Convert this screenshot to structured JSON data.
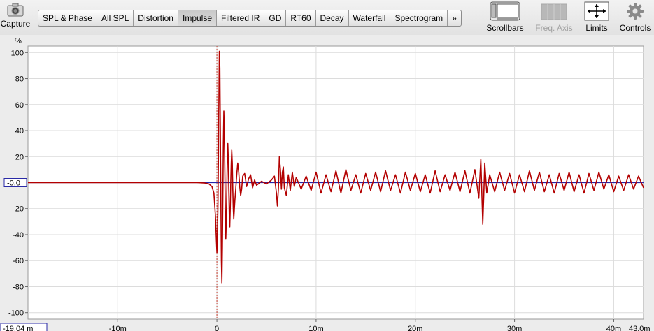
{
  "toolbar": {
    "capture_label": "Capture",
    "scrollbars_label": "Scrollbars",
    "freq_axis_label": "Freq. Axis",
    "limits_label": "Limits",
    "controls_label": "Controls",
    "tabs": [
      {
        "label": "SPL & Phase",
        "active": false
      },
      {
        "label": "All SPL",
        "active": false
      },
      {
        "label": "Distortion",
        "active": false
      },
      {
        "label": "Impulse",
        "active": true
      },
      {
        "label": "Filtered IR",
        "active": false
      },
      {
        "label": "GD",
        "active": false
      },
      {
        "label": "RT60",
        "active": false
      },
      {
        "label": "Decay",
        "active": false
      },
      {
        "label": "Waterfall",
        "active": false
      },
      {
        "label": "Spectrogram",
        "active": false
      },
      {
        "label": "»",
        "active": false
      }
    ]
  },
  "chart_data": {
    "type": "line",
    "ylabel": "%",
    "xlim": [
      -19.04,
      43.0
    ],
    "ylim": [
      -105,
      105
    ],
    "xunit": "m",
    "yticks": [
      100,
      80,
      60,
      40,
      20,
      -20,
      -40,
      -60,
      -80,
      -100
    ],
    "xticks": [
      {
        "value": -10,
        "label": "-10m"
      },
      {
        "value": 0,
        "label": "0"
      },
      {
        "value": 10,
        "label": "10m"
      },
      {
        "value": 20,
        "label": "20m"
      },
      {
        "value": 30,
        "label": "30m"
      },
      {
        "value": 40,
        "label": "40m"
      }
    ],
    "x_start_label": "-19.04 m",
    "x_end_label": "43.0m",
    "y_cursor_label": "-0.0",
    "grid": true,
    "cursor_x": 0,
    "colors": {
      "impulse": "#b30000",
      "envelope": "#2424a8",
      "cursor": "#c0392b",
      "axis_box": "#2a2aa6"
    },
    "series": [
      {
        "points": [
          [
            -19.04,
            0
          ],
          [
            -2,
            0
          ],
          [
            -1.2,
            -0.3
          ],
          [
            -0.8,
            -1
          ],
          [
            -0.5,
            -3
          ],
          [
            -0.3,
            -8
          ],
          [
            -0.15,
            -25
          ],
          [
            -0.05,
            -45
          ],
          [
            0.0,
            -54
          ],
          [
            0.05,
            -40
          ],
          [
            0.1,
            -20
          ],
          [
            0.15,
            15
          ],
          [
            0.2,
            60
          ],
          [
            0.25,
            101
          ],
          [
            0.3,
            88
          ],
          [
            0.35,
            40
          ],
          [
            0.4,
            -10
          ],
          [
            0.45,
            -60
          ],
          [
            0.5,
            -77
          ],
          [
            0.55,
            -50
          ],
          [
            0.6,
            -10
          ],
          [
            0.65,
            30
          ],
          [
            0.7,
            55
          ],
          [
            0.75,
            40
          ],
          [
            0.8,
            10
          ],
          [
            0.85,
            -20
          ],
          [
            0.9,
            -43
          ],
          [
            0.95,
            -30
          ],
          [
            1.0,
            -5
          ],
          [
            1.05,
            20
          ],
          [
            1.1,
            30
          ],
          [
            1.15,
            18
          ],
          [
            1.2,
            -5
          ],
          [
            1.25,
            -25
          ],
          [
            1.3,
            -34
          ],
          [
            1.35,
            -20
          ],
          [
            1.4,
            0
          ],
          [
            1.45,
            15
          ],
          [
            1.5,
            25
          ],
          [
            1.55,
            15
          ],
          [
            1.6,
            -5
          ],
          [
            1.65,
            -20
          ],
          [
            1.7,
            -28
          ],
          [
            1.8,
            -15
          ],
          [
            1.9,
            -5
          ],
          [
            2.0,
            6
          ],
          [
            2.1,
            15
          ],
          [
            2.2,
            8
          ],
          [
            2.3,
            -3
          ],
          [
            2.4,
            -10
          ],
          [
            2.5,
            -5
          ],
          [
            2.6,
            5
          ],
          [
            2.8,
            7
          ],
          [
            3.0,
            -3
          ],
          [
            3.2,
            3
          ],
          [
            3.4,
            6
          ],
          [
            3.6,
            -4
          ],
          [
            3.8,
            2
          ],
          [
            4.0,
            -2
          ],
          [
            4.5,
            1
          ],
          [
            5.0,
            -1
          ],
          [
            5.5,
            2
          ],
          [
            5.8,
            5
          ],
          [
            6.0,
            -8
          ],
          [
            6.1,
            -18
          ],
          [
            6.2,
            -5
          ],
          [
            6.3,
            20
          ],
          [
            6.4,
            10
          ],
          [
            6.5,
            -5
          ],
          [
            6.6,
            8
          ],
          [
            6.7,
            12
          ],
          [
            6.8,
            -4
          ],
          [
            7.0,
            -10
          ],
          [
            7.2,
            6
          ],
          [
            7.4,
            -6
          ],
          [
            7.6,
            8
          ],
          [
            7.8,
            -3
          ],
          [
            8.0,
            4
          ],
          [
            8.5,
            -5
          ],
          [
            9.0,
            5
          ],
          [
            9.5,
            -6
          ],
          [
            10.0,
            8
          ],
          [
            10.5,
            -8
          ],
          [
            11.0,
            6
          ],
          [
            11.5,
            -7
          ],
          [
            12.0,
            9
          ],
          [
            12.5,
            -8
          ],
          [
            13.0,
            10
          ],
          [
            13.5,
            -6
          ],
          [
            14.0,
            6
          ],
          [
            14.5,
            -8
          ],
          [
            15.0,
            7
          ],
          [
            15.5,
            -6
          ],
          [
            16.0,
            8
          ],
          [
            16.5,
            -7
          ],
          [
            17.0,
            9
          ],
          [
            17.5,
            -6
          ],
          [
            18.0,
            6
          ],
          [
            18.5,
            -8
          ],
          [
            19.0,
            8
          ],
          [
            19.5,
            -6
          ],
          [
            20.0,
            7
          ],
          [
            20.5,
            -7
          ],
          [
            21.0,
            6
          ],
          [
            21.5,
            -8
          ],
          [
            22.0,
            9
          ],
          [
            22.5,
            -7
          ],
          [
            23.0,
            6
          ],
          [
            23.5,
            -6
          ],
          [
            24.0,
            8
          ],
          [
            24.5,
            -7
          ],
          [
            25.0,
            9
          ],
          [
            25.5,
            -8
          ],
          [
            26.0,
            10
          ],
          [
            26.4,
            -12
          ],
          [
            26.6,
            18
          ],
          [
            26.8,
            -32
          ],
          [
            26.9,
            -10
          ],
          [
            27.0,
            15
          ],
          [
            27.2,
            -8
          ],
          [
            27.5,
            6
          ],
          [
            28.0,
            -7
          ],
          [
            28.5,
            8
          ],
          [
            29.0,
            -6
          ],
          [
            29.5,
            7
          ],
          [
            30.0,
            -8
          ],
          [
            30.5,
            6
          ],
          [
            31.0,
            -7
          ],
          [
            31.5,
            9
          ],
          [
            32.0,
            -6
          ],
          [
            32.5,
            8
          ],
          [
            33.0,
            -7
          ],
          [
            33.5,
            6
          ],
          [
            34.0,
            -8
          ],
          [
            34.5,
            7
          ],
          [
            35.0,
            -6
          ],
          [
            35.5,
            8
          ],
          [
            36.0,
            -7
          ],
          [
            36.5,
            6
          ],
          [
            37.0,
            -8
          ],
          [
            37.5,
            7
          ],
          [
            38.0,
            -6
          ],
          [
            38.5,
            8
          ],
          [
            39.0,
            -5
          ],
          [
            39.5,
            6
          ],
          [
            40.0,
            -7
          ],
          [
            40.5,
            5
          ],
          [
            41.0,
            -6
          ],
          [
            41.5,
            6
          ],
          [
            42.0,
            -5
          ],
          [
            42.5,
            5
          ],
          [
            43.0,
            -4
          ]
        ]
      }
    ]
  }
}
